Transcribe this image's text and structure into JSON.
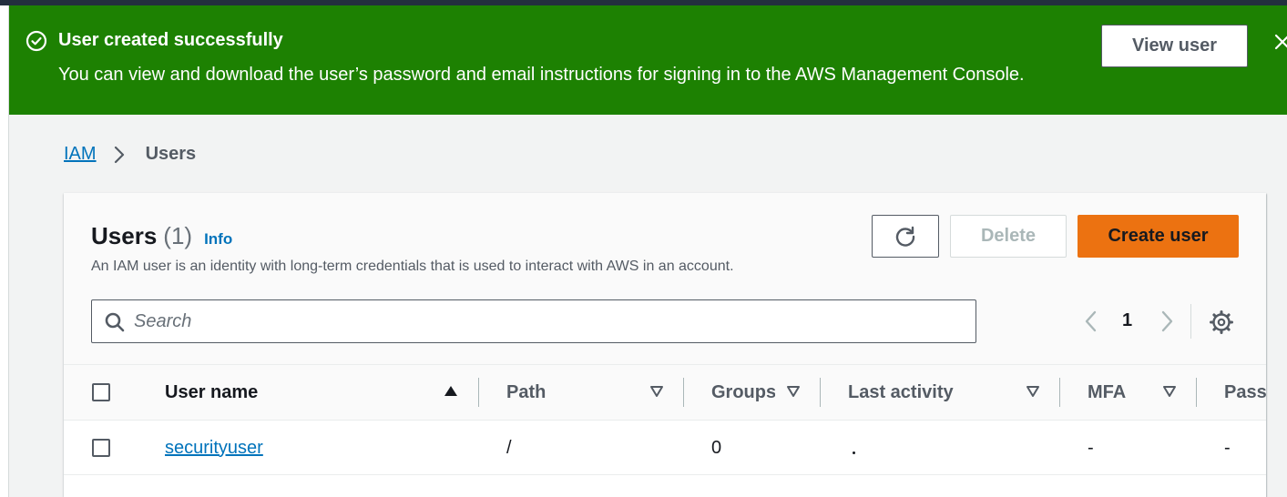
{
  "flash": {
    "title": "User created successfully",
    "message": "You can view and download the user’s password and email instructions for signing in to the AWS Management Console.",
    "view_user_label": "View user",
    "color": "#1d8102"
  },
  "breadcrumb": {
    "root": "IAM",
    "current": "Users"
  },
  "panel": {
    "title": "Users",
    "count": "(1)",
    "info": "Info",
    "description": "An IAM user is an identity with long-term credentials that is used to interact with AWS in an account.",
    "delete_label": "Delete",
    "create_label": "Create user",
    "accent": "#ec7211"
  },
  "search": {
    "placeholder": "Search",
    "value": ""
  },
  "pagination": {
    "current_page": "1"
  },
  "table": {
    "columns": [
      "User name",
      "Path",
      "Groups",
      "Last activity",
      "MFA",
      "Passw"
    ],
    "rows": [
      {
        "user_name": "securityuser",
        "path": "/",
        "groups": "0",
        "last_activity": "",
        "mfa": "-",
        "password": "-"
      }
    ]
  },
  "icons": {
    "flash": "check-circle-icon",
    "close": "close-icon",
    "breadcrumb_sep": "chevron-right-icon",
    "refresh": "refresh-icon",
    "search": "search-icon",
    "prev": "chevron-left-icon",
    "next": "chevron-right-icon",
    "settings": "gear-icon",
    "sort_asc": "caret-up-icon",
    "sort": "caret-down-icon"
  }
}
